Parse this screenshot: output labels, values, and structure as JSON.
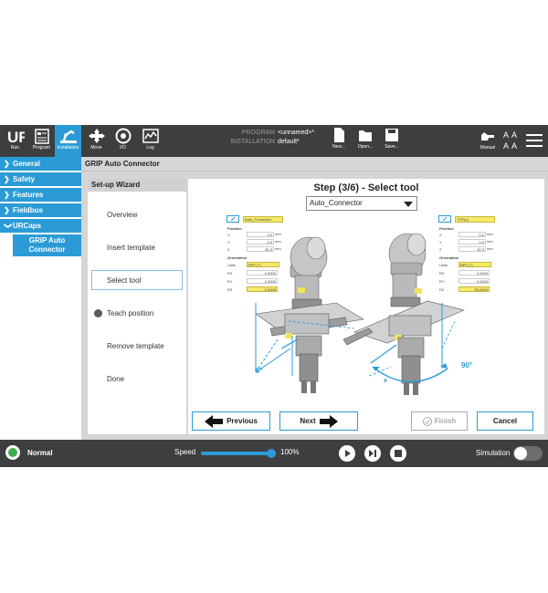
{
  "topbar": {
    "nav": [
      {
        "label": "Run",
        "icon": "ur-logo-icon"
      },
      {
        "label": "Program",
        "icon": "program-icon"
      },
      {
        "label": "Installation",
        "icon": "installation-icon"
      },
      {
        "label": "Move",
        "icon": "move-icon"
      },
      {
        "label": "I/O",
        "icon": "io-icon"
      },
      {
        "label": "Log",
        "icon": "log-icon"
      }
    ],
    "program_label": "PROGRAM",
    "program_value": "<unnamed>*",
    "installation_label": "INSTALLATION",
    "installation_value": "default*",
    "file_buttons": [
      {
        "label": "New...",
        "icon": "new-file-icon"
      },
      {
        "label": "Open...",
        "icon": "open-folder-icon"
      },
      {
        "label": "Save...",
        "icon": "save-icon"
      }
    ],
    "manual_label": "Manual"
  },
  "sidebar": {
    "items": [
      {
        "label": "General",
        "expanded": false
      },
      {
        "label": "Safety",
        "expanded": false
      },
      {
        "label": "Features",
        "expanded": false
      },
      {
        "label": "Fieldbus",
        "expanded": false
      },
      {
        "label": "URCaps",
        "expanded": true
      }
    ],
    "subitem": "GRIP Auto Connector"
  },
  "main": {
    "title": "GRIP Auto Connector",
    "wizard_title": "Set-up Wizard",
    "steps": [
      "Overview",
      "Insert template",
      "Select tool",
      "Teach position",
      "Remove template",
      "Done"
    ],
    "active_step": "Select tool",
    "step_title": "Step (3/6) - Select tool",
    "tool_selected": "Auto_Connector",
    "left_form": {
      "dropdown": "Auto_Connector",
      "position_label": "Position",
      "rows": [
        {
          "axis": "X",
          "value": "0.0",
          "unit": "mm"
        },
        {
          "axis": "Y",
          "value": "0.0",
          "unit": "mm"
        },
        {
          "axis": "Z",
          "value": "30.3",
          "unit": "mm"
        }
      ],
      "orientation_label": "Orientation",
      "units_label": "Units",
      "units_value": "RPY (°)",
      "orient_rows": [
        {
          "axis": "RX",
          "value": "0.0000"
        },
        {
          "axis": "RY",
          "value": "0.0000"
        },
        {
          "axis": "RZ",
          "value": "0.0000"
        }
      ],
      "angle_label": "0°"
    },
    "right_form": {
      "dropdown": "TCP(x)",
      "position_label": "Position",
      "rows": [
        {
          "axis": "X",
          "value": "0.0",
          "unit": "mm"
        },
        {
          "axis": "Y",
          "value": "0.0",
          "unit": "mm"
        },
        {
          "axis": "Z",
          "value": "30.3",
          "unit": "mm"
        }
      ],
      "orientation_label": "Orientation",
      "units_label": "Units",
      "units_value": "RPY (°)",
      "orient_rows": [
        {
          "axis": "RX",
          "value": "0.0000"
        },
        {
          "axis": "RY",
          "value": "0.0000"
        },
        {
          "axis": "RZ",
          "value": "90.0000"
        }
      ],
      "angle_label": "90°",
      "axis_label": "x"
    },
    "buttons": {
      "previous": "Previous",
      "next": "Next",
      "finish": "Finish",
      "cancel": "Cancel"
    }
  },
  "bottombar": {
    "status": "Normal",
    "speed_label": "Speed",
    "speed_value": "100%",
    "speed_fraction": 1.0,
    "simulation_label": "Simulation"
  },
  "colors": {
    "accent": "#2b9bd6",
    "topbar": "#3d3e40",
    "status_green": "#3fae49",
    "field_yellow": "#f5e96a"
  }
}
